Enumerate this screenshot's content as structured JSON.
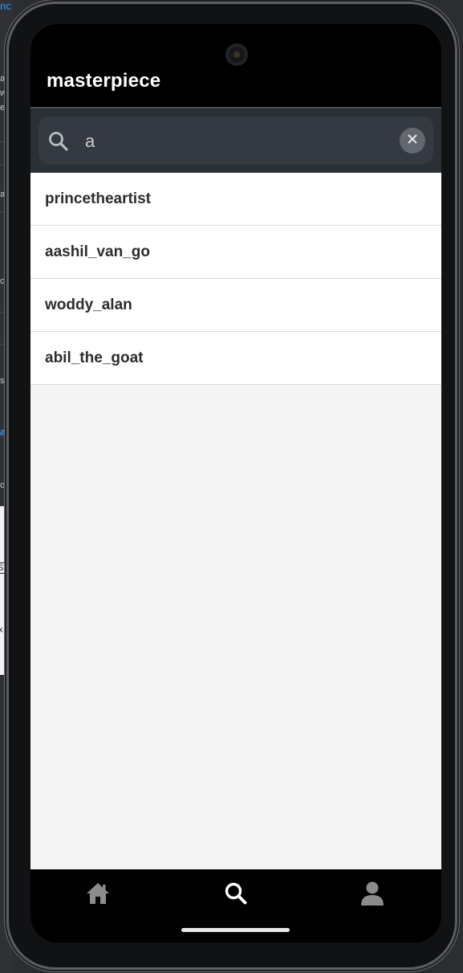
{
  "background": {
    "fragments": [
      "nc",
      "ate",
      "wn",
      "er",
      "ar",
      "co",
      "s g",
      "ati",
      "on",
      "S",
      "x"
    ]
  },
  "app": {
    "title": "masterpiece"
  },
  "search": {
    "value": "a",
    "placeholder": ""
  },
  "results": [
    "princetheartist",
    "aashil_van_go",
    "woddy_alan",
    "abil_the_goat"
  ],
  "nav": {
    "items": [
      {
        "icon": "home-icon",
        "active": false
      },
      {
        "icon": "search-icon",
        "active": true
      },
      {
        "icon": "profile-icon",
        "active": false
      }
    ]
  },
  "colors": {
    "app_bar": "#000000",
    "search_area": "#2b2f36",
    "list_bg": "#f4f4f4",
    "nav_active": "#ffffff",
    "nav_inactive": "#8c8c8c"
  }
}
